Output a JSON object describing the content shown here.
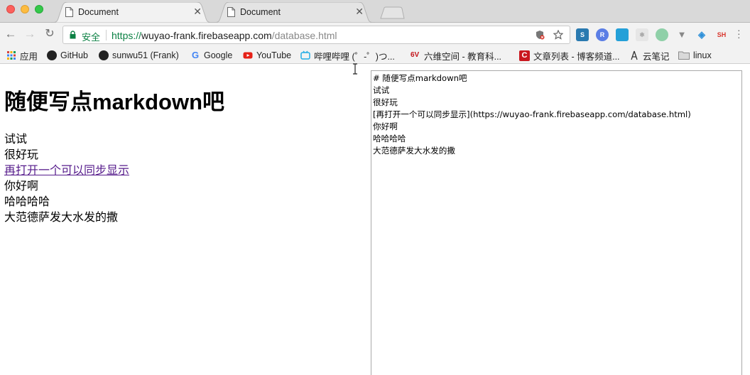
{
  "tabs": [
    {
      "title": "Document",
      "active": true
    },
    {
      "title": "Document",
      "active": false
    }
  ],
  "toolbar": {
    "secure_label": "安全",
    "url_proto": "https://",
    "url_host": "wuyao-frank.firebaseapp.com",
    "url_path": "/database.html"
  },
  "extensions": [
    {
      "name": "s-extension-icon",
      "label": "",
      "color": "#2a7ab0"
    },
    {
      "name": "r-extension-icon",
      "label": "R",
      "color": "#5b7ee5"
    },
    {
      "name": "window-extension-icon",
      "label": "",
      "color": "#24a0d8"
    },
    {
      "name": "react-extension-icon",
      "label": "",
      "color": "#dcdcdc"
    },
    {
      "name": "circle-extension-icon",
      "label": "",
      "color": "#8fd0a8"
    },
    {
      "name": "vue-extension-icon",
      "label": "",
      "color": "#888888"
    },
    {
      "name": "layers-extension-icon",
      "label": "",
      "color": "#2d8fd8"
    },
    {
      "name": "sh-extension-icon",
      "label": "SH",
      "color": "#f2f2f2"
    }
  ],
  "bookmarks": [
    {
      "label": "应用",
      "icon": "apps-grid-icon"
    },
    {
      "label": "GitHub",
      "icon": "github-icon"
    },
    {
      "label": "sunwu51 (Frank)",
      "icon": "github-icon"
    },
    {
      "label": "Google",
      "icon": "google-icon"
    },
    {
      "label": "YouTube",
      "icon": "youtube-icon"
    },
    {
      "label": "哔哩哔哩 (゜-゜)つ...",
      "icon": "bilibili-icon"
    },
    {
      "label": "六维空间 - 教育科...",
      "icon": "liuwei-icon"
    },
    {
      "label": "文章列表 - 博客频道...",
      "icon": "csdn-icon"
    },
    {
      "label": "云笔记",
      "icon": "cloud-note-icon"
    },
    {
      "label": "linux",
      "icon": "folder-icon"
    }
  ],
  "preview": {
    "heading": "随便写点markdown吧",
    "line1": "试试",
    "line2": "很好玩",
    "link": "再打开一个可以同步显示",
    "line3": "你好啊",
    "line4": "哈哈哈哈",
    "line5": "大范德萨发大水发的撒"
  },
  "editor": {
    "content": "# 随便写点markdown吧\n试试\n很好玩\n[再打开一个可以同步显示](https://wuyao-frank.firebaseapp.com/database.html)\n你好啊\n哈哈哈哈\n大范德萨发大水发的撒"
  }
}
